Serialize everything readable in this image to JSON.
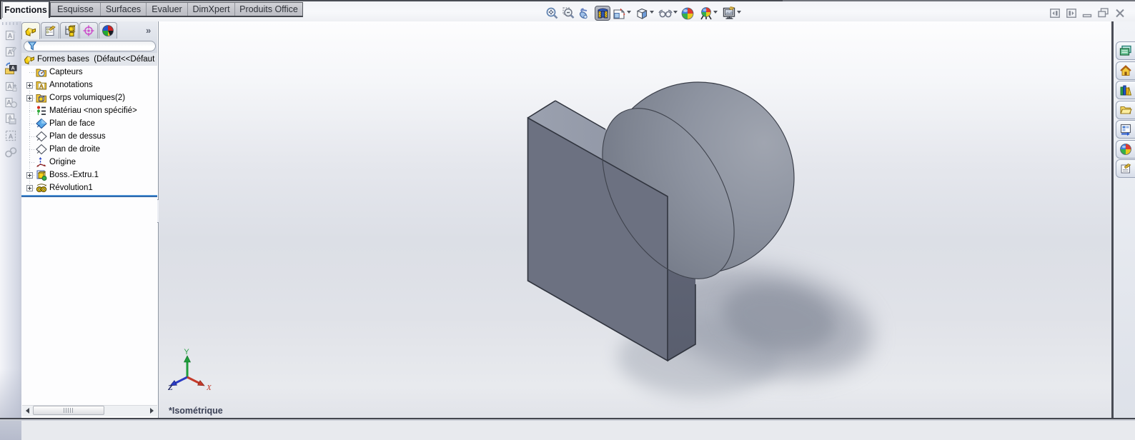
{
  "command_tabs": {
    "items": [
      {
        "label": "Fonctions",
        "active": true
      },
      {
        "label": "Esquisse",
        "active": false
      },
      {
        "label": "Surfaces",
        "active": false
      },
      {
        "label": "Evaluer",
        "active": false
      },
      {
        "label": "DimXpert",
        "active": false
      },
      {
        "label": "Produits Office",
        "active": false
      }
    ]
  },
  "headsup_toolbar": {
    "buttons": [
      {
        "name": "zoom-to-fit"
      },
      {
        "name": "zoom-to-area"
      },
      {
        "name": "previous-view"
      },
      {
        "name": "section-view",
        "pressed": true
      },
      {
        "name": "view-orientation",
        "dropdown": true
      },
      {
        "name": "display-style",
        "dropdown": true
      },
      {
        "name": "hide-show-items",
        "dropdown": true
      },
      {
        "name": "edit-appearance"
      },
      {
        "name": "apply-scene",
        "dropdown": true
      },
      {
        "name": "view-settings",
        "dropdown": true
      }
    ]
  },
  "window_controls": [
    {
      "name": "collapse-pane-left"
    },
    {
      "name": "expand-pane-right"
    },
    {
      "name": "minimize"
    },
    {
      "name": "restore"
    },
    {
      "name": "close"
    }
  ],
  "left_toolbar": {
    "buttons": [
      {
        "name": "note"
      },
      {
        "name": "note-edit"
      },
      {
        "name": "insert-annotation-view",
        "enabled": true
      },
      {
        "name": "add-annotation"
      },
      {
        "name": "balloon"
      },
      {
        "name": "annotation-save"
      },
      {
        "name": "annotation-area"
      },
      {
        "name": "weld-symbol"
      }
    ]
  },
  "feature_manager": {
    "tabs": [
      {
        "name": "features-tab",
        "active": true
      },
      {
        "name": "property-manager-tab",
        "active": false
      },
      {
        "name": "configuration-manager-tab",
        "active": false
      },
      {
        "name": "dimxpert-manager-tab",
        "active": false
      },
      {
        "name": "display-manager-tab",
        "active": false
      }
    ],
    "overflow_label": "»",
    "filter": {
      "value": "",
      "icon": "filter-funnel-icon"
    },
    "tree": [
      {
        "label": "Formes bases  (Défaut<<Défaut",
        "icon": "part",
        "level": 0,
        "expandable": false
      },
      {
        "label": "Capteurs",
        "icon": "sensors-folder",
        "level": 1,
        "expandable": false
      },
      {
        "label": "Annotations",
        "icon": "annotations-folder",
        "level": 1,
        "expandable": true
      },
      {
        "label": "Corps volumiques(2)",
        "icon": "solid-bodies-folder",
        "level": 1,
        "expandable": true
      },
      {
        "label": "Matériau <non spécifié>",
        "icon": "material",
        "level": 1,
        "expandable": false
      },
      {
        "label": "Plan de face",
        "icon": "plane-selected",
        "level": 1,
        "expandable": false
      },
      {
        "label": "Plan de dessus",
        "icon": "plane",
        "level": 1,
        "expandable": false
      },
      {
        "label": "Plan de droite",
        "icon": "plane",
        "level": 1,
        "expandable": false
      },
      {
        "label": "Origine",
        "icon": "origin",
        "level": 1,
        "expandable": false
      },
      {
        "label": "Boss.-Extru.1",
        "icon": "extrude",
        "level": 1,
        "expandable": true
      },
      {
        "label": "Révolution1",
        "icon": "revolve",
        "level": 1,
        "expandable": true
      }
    ]
  },
  "task_pane": {
    "tabs": [
      {
        "name": "solidworks-resources"
      },
      {
        "name": "home-resources"
      },
      {
        "name": "design-library"
      },
      {
        "name": "file-explorer"
      },
      {
        "name": "view-palette"
      },
      {
        "name": "appearances-scenes"
      },
      {
        "name": "custom-properties"
      }
    ]
  },
  "viewport": {
    "view_label": "*Isométrique",
    "triad": {
      "y_label": "Y",
      "z_label": "Z",
      "x_label": "X"
    },
    "colors": {
      "plate_front": "#6c7181",
      "plate_top": "#999fad",
      "plate_side": "#5f6474",
      "sphere_light": "#a9aeb8",
      "sphere_dark": "#5b6070",
      "edge": "#30343e"
    }
  }
}
